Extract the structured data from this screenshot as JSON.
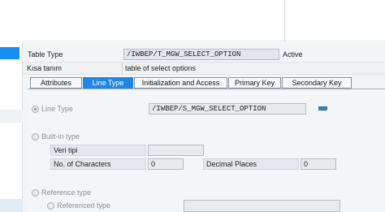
{
  "header": {
    "table_type_label": "Table Type",
    "table_type_value": "/IWBEP/T_MGW_SELECT_OPTION",
    "status": "Active",
    "short_text_label": "Kısa tanım",
    "short_text_value": "table of select options"
  },
  "tabs": [
    {
      "label": "Attributes",
      "active": false
    },
    {
      "label": "Line Type",
      "active": true
    },
    {
      "label": "Initialization and Access",
      "active": false
    },
    {
      "label": "Primary Key",
      "active": false
    },
    {
      "label": "Secondary Key",
      "active": false
    }
  ],
  "line_type": {
    "label": "Line Type",
    "value": "/IWBEP/S_MGW_SELECT_OPTION",
    "selected": true
  },
  "builtin": {
    "label": "Built-in type",
    "data_type_label": "Veri tipi",
    "data_type_value": "",
    "chars_label": "No. of Characters",
    "chars_value": "0",
    "decimals_label": "Decimal Places",
    "decimals_value": "0"
  },
  "reference": {
    "label": "Reference type",
    "referenced_label": "Referenced type"
  },
  "colors": {
    "active_tab": "#1f86e6",
    "selection": "#1b8ef2"
  }
}
